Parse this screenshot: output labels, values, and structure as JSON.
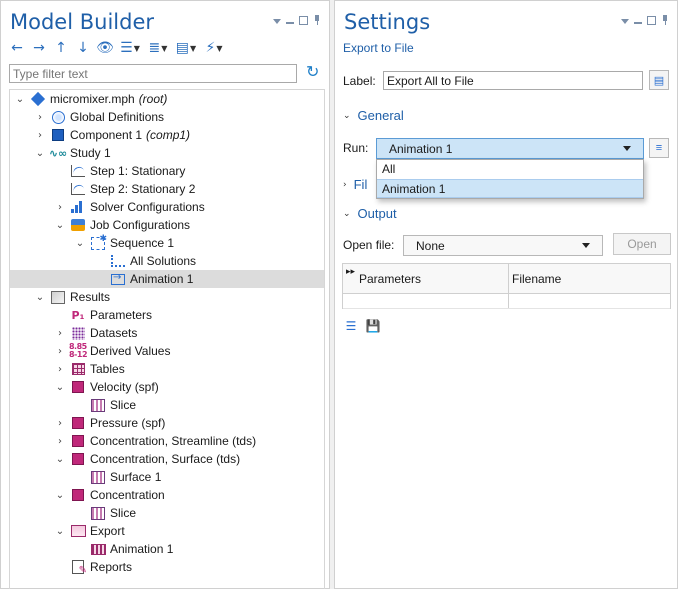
{
  "left": {
    "title": "Model Builder",
    "filter_placeholder": "Type filter text",
    "tree": [
      {
        "label": "micromixer.mph",
        "tag": "(root)",
        "level": 0,
        "toggle": "v",
        "icon": "diamond"
      },
      {
        "label": "Global Definitions",
        "tag": "",
        "level": 1,
        "toggle": ">",
        "icon": "globe"
      },
      {
        "label": "Component 1",
        "tag": "(comp1)",
        "level": 1,
        "toggle": ">",
        "icon": "cube-blue"
      },
      {
        "label": "Study 1",
        "tag": "",
        "level": 1,
        "toggle": "v",
        "icon": "study"
      },
      {
        "label": "Step 1: Stationary",
        "tag": "",
        "level": 2,
        "toggle": "",
        "icon": "graph"
      },
      {
        "label": "Step 2: Stationary 2",
        "tag": "",
        "level": 2,
        "toggle": "",
        "icon": "graph"
      },
      {
        "label": "Solver Configurations",
        "tag": "",
        "level": 2,
        "toggle": ">",
        "icon": "bars"
      },
      {
        "label": "Job Configurations",
        "tag": "",
        "level": 2,
        "toggle": "v",
        "icon": "job"
      },
      {
        "label": "Sequence 1",
        "tag": "",
        "level": 3,
        "toggle": "v",
        "icon": "seq"
      },
      {
        "label": "All Solutions",
        "tag": "",
        "level": 4,
        "toggle": "",
        "icon": "sol"
      },
      {
        "label": "Animation 1",
        "tag": "",
        "level": 4,
        "toggle": "",
        "icon": "anim",
        "selected": true
      },
      {
        "label": "Results",
        "tag": "",
        "level": 1,
        "toggle": "v",
        "icon": "results"
      },
      {
        "label": "Parameters",
        "tag": "",
        "level": 2,
        "toggle": "",
        "icon": "params"
      },
      {
        "label": "Datasets",
        "tag": "",
        "level": 2,
        "toggle": ">",
        "icon": "grid"
      },
      {
        "label": "Derived Values",
        "tag": "",
        "level": 2,
        "toggle": ">",
        "icon": "derived"
      },
      {
        "label": "Tables",
        "tag": "",
        "level": 2,
        "toggle": ">",
        "icon": "table"
      },
      {
        "label": "Velocity (spf)",
        "tag": "",
        "level": 2,
        "toggle": "v",
        "icon": "cube-mag"
      },
      {
        "label": "Slice",
        "tag": "",
        "level": 3,
        "toggle": "",
        "icon": "slice"
      },
      {
        "label": "Pressure (spf)",
        "tag": "",
        "level": 2,
        "toggle": ">",
        "icon": "cube-mag"
      },
      {
        "label": "Concentration, Streamline (tds)",
        "tag": "",
        "level": 2,
        "toggle": ">",
        "icon": "cube-mag"
      },
      {
        "label": "Concentration, Surface (tds)",
        "tag": "",
        "level": 2,
        "toggle": "v",
        "icon": "cube-mag"
      },
      {
        "label": "Surface 1",
        "tag": "",
        "level": 3,
        "toggle": "",
        "icon": "slice"
      },
      {
        "label": "Concentration",
        "tag": "",
        "level": 2,
        "toggle": "v",
        "icon": "cube-mag"
      },
      {
        "label": "Slice",
        "tag": "",
        "level": 3,
        "toggle": "",
        "icon": "slice"
      },
      {
        "label": "Export",
        "tag": "",
        "level": 2,
        "toggle": "v",
        "icon": "export"
      },
      {
        "label": "Animation 1",
        "tag": "",
        "level": 3,
        "toggle": "",
        "icon": "anim-mag"
      },
      {
        "label": "Reports",
        "tag": "",
        "level": 2,
        "toggle": "",
        "icon": "report"
      }
    ]
  },
  "right": {
    "title": "Settings",
    "subtitle": "Export to File",
    "label_caption": "Label:",
    "label_value": "Export All to File",
    "general_title": "General",
    "run_caption": "Run:",
    "run_value": "Animation 1",
    "run_options": [
      "All",
      "Animation 1"
    ],
    "file_section_partial": "Fil",
    "output_title": "Output",
    "open_file_caption": "Open file:",
    "open_file_value": "None",
    "open_button": "Open",
    "table_headers": [
      "Parameters",
      "Filename"
    ]
  }
}
